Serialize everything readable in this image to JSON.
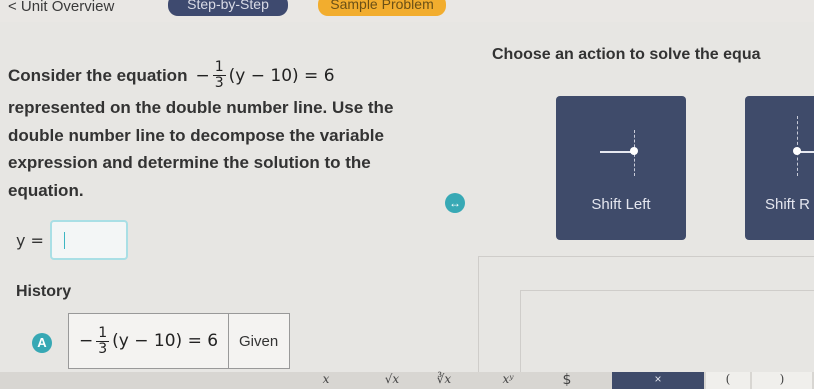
{
  "topbar": {
    "back_label": "< Unit Overview",
    "tab_step": "Step-by-Step",
    "tab_sample": "Sample Problem"
  },
  "question": {
    "intro": "Consider the equation",
    "equation": {
      "sign": "−",
      "numerator": "1",
      "denominator": "3",
      "rest": "(y − 10) = 6"
    },
    "body": "represented on the double number line. Use the double number line to decompose the variable expression and determine the solution to the equation."
  },
  "answer": {
    "variable": "y =",
    "value": ""
  },
  "history": {
    "title": "History",
    "rows": [
      {
        "badge": "A",
        "equation": {
          "sign": "−",
          "numerator": "1",
          "denominator": "3",
          "rest": "(y − 10) = 6"
        },
        "reason": "Given"
      }
    ]
  },
  "actions": {
    "heading": "Choose an action to solve the equa",
    "buttons": [
      {
        "label": "Shift Left",
        "icon": "arrow-left-number-line-icon"
      },
      {
        "label": "Shift R",
        "icon": "arrow-right-number-line-icon"
      }
    ]
  },
  "keypad": {
    "keys": [
      "x",
      "√x",
      "∛x",
      "xʸ",
      "$",
      "×",
      "(",
      ")"
    ]
  },
  "colors": {
    "accent_teal": "#37a8b4",
    "card_navy": "#3f4b6a",
    "tab_orange": "#f2ad2e"
  }
}
